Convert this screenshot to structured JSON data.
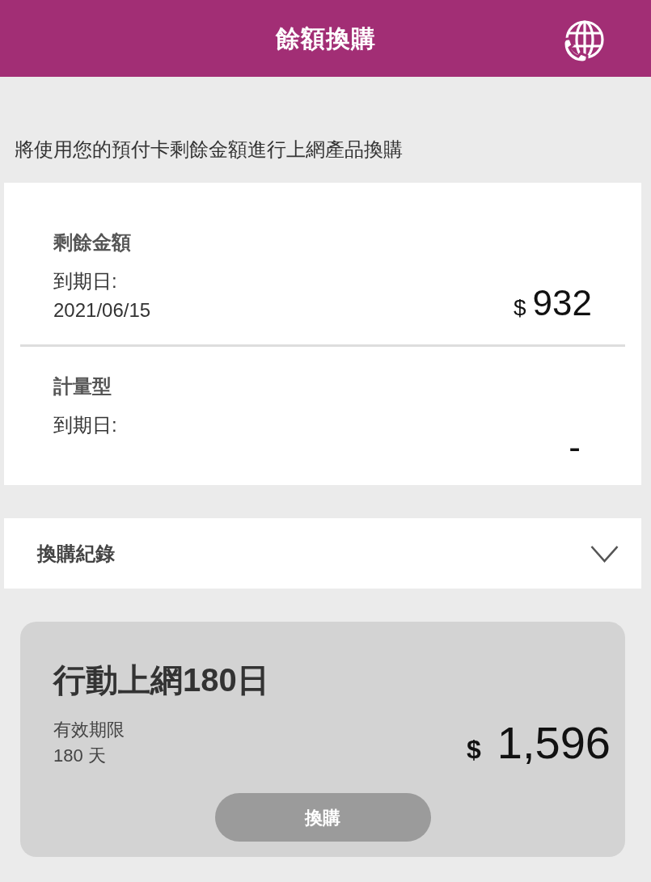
{
  "header": {
    "title": "餘額換購"
  },
  "intro": "將使用您的預付卡剩餘金額進行上網產品換購",
  "balances": [
    {
      "label": "剩餘金額",
      "expiry_label": "到期日:",
      "expiry_date": "2021/06/15",
      "currency": "$",
      "amount": "932"
    },
    {
      "label": "計量型",
      "expiry_label": "到期日:",
      "amount": "-"
    }
  ],
  "history": {
    "label": "換購紀錄",
    "expanded": false
  },
  "products": [
    {
      "name": "行動上網180日",
      "validity_label": "有效期限",
      "validity": "180 天",
      "currency": "$",
      "price": "1,596",
      "button": "換購",
      "disabled": true
    }
  ]
}
